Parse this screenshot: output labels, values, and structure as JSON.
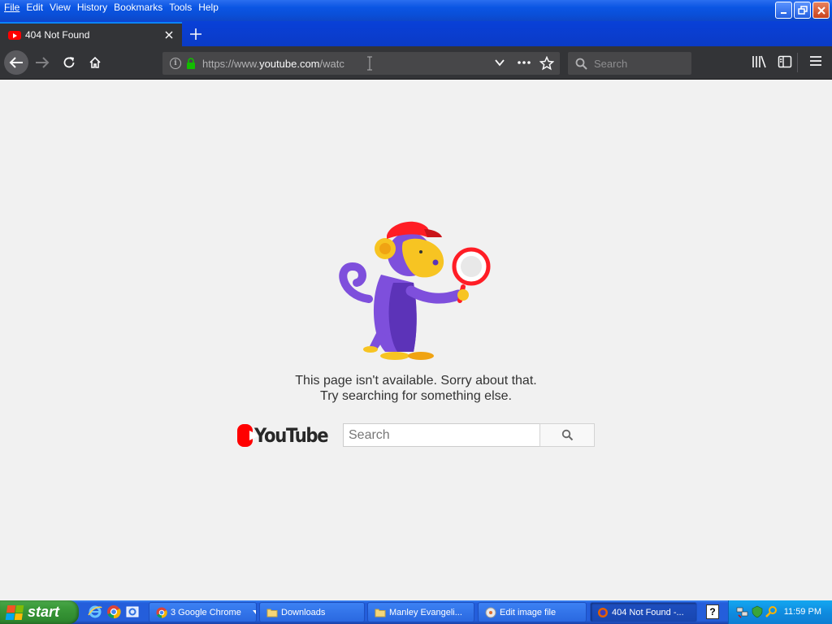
{
  "menubar": {
    "items": [
      "File",
      "Edit",
      "View",
      "History",
      "Bookmarks",
      "Tools",
      "Help"
    ]
  },
  "tab": {
    "title": "404 Not Found"
  },
  "urlbar": {
    "url_prefix": "https://www.",
    "url_domain": "youtube.com",
    "url_suffix": "/watc"
  },
  "searchbar": {
    "placeholder": "Search"
  },
  "page": {
    "message_line1": "This page isn't available. Sorry about that.",
    "message_line2": "Try searching for something else.",
    "logo_text": "YouTube",
    "search_placeholder": "Search"
  },
  "taskbar": {
    "start_label": "start",
    "buttons": [
      {
        "label": "3 Google Chrome"
      },
      {
        "label": "Downloads"
      },
      {
        "label": "Manley Evangeli..."
      },
      {
        "label": "Edit image file"
      },
      {
        "label": "404 Not Found -..."
      }
    ],
    "help_label": "?",
    "clock": "11:59 PM"
  },
  "colors": {
    "accent": "#0a84ff",
    "youtube_red": "#ff0000",
    "toolbar": "#333437",
    "xp_blue": "#245edb",
    "start_green": "#3b9a3a",
    "lock_green": "#12bc00"
  }
}
